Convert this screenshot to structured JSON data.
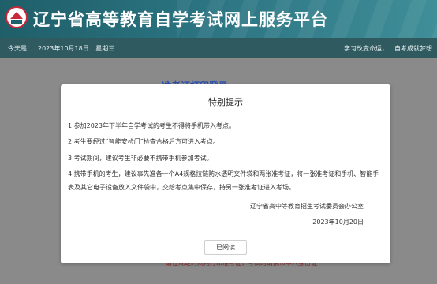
{
  "header": {
    "title": "辽宁省高等教育自学考试网上服务平台"
  },
  "datebar": {
    "today_label": "今天是：",
    "date": "2023年10月18日",
    "weekday": "星期三",
    "slogan1": "学习改变命运，",
    "slogan2": "自考成就梦想"
  },
  "background": {
    "heading": "准考证打印登录",
    "bottom_text": "请在规定时间内打印准考证，考试时请携带本人身份证"
  },
  "modal": {
    "title": "特别提示",
    "items": [
      "1.参加2023年下半年自学考试的考生不得将手机带入考点。",
      "2.考生要经过“智能安检门”检查合格后方可进入考点。",
      "3.考试期间，建议考生非必要不携带手机参加考试。",
      "4.携带手机的考生，建议事先准备一个A4规格拉链防水透明文件袋和两张准考证，将一张准考证和手机、智能手表及其它电子设备放入文件袋中，交给考点集中保存，持另一张准考证进入考场。"
    ],
    "signer": "辽宁省高中等教育招生考试委员会办公室",
    "date": "2023年10月20日",
    "ok_button": "已阅读"
  },
  "colors": {
    "header_bg": "#2b7381",
    "datebar_bg": "#2f5a60",
    "overlay": "#8a8a8a",
    "heading_blue": "#2b4fb0"
  }
}
